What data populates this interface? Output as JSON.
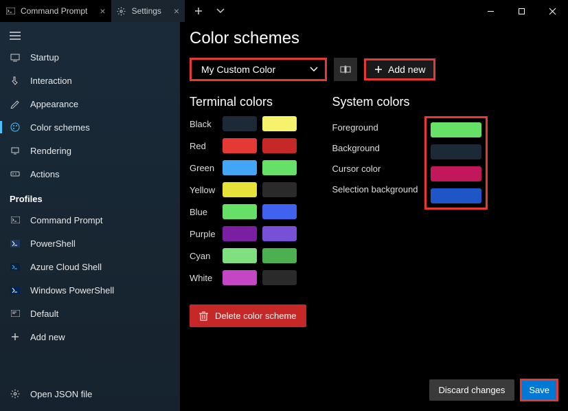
{
  "tabs": [
    {
      "label": "Command Prompt",
      "icon": "cmd"
    },
    {
      "label": "Settings",
      "icon": "gear"
    }
  ],
  "window_controls": {
    "new_tab": "+",
    "dropdown": "˅"
  },
  "sidebar": {
    "items": [
      {
        "label": "Startup",
        "icon": "startup"
      },
      {
        "label": "Interaction",
        "icon": "interaction"
      },
      {
        "label": "Appearance",
        "icon": "appearance"
      },
      {
        "label": "Color schemes",
        "icon": "palette",
        "selected": true
      },
      {
        "label": "Rendering",
        "icon": "rendering"
      },
      {
        "label": "Actions",
        "icon": "actions"
      }
    ],
    "profiles_header": "Profiles",
    "profiles": [
      {
        "label": "Command Prompt",
        "icon": "cmd"
      },
      {
        "label": "PowerShell",
        "icon": "ps"
      },
      {
        "label": "Azure Cloud Shell",
        "icon": "azure"
      },
      {
        "label": "Windows PowerShell",
        "icon": "ps"
      },
      {
        "label": "Default",
        "icon": "default"
      }
    ],
    "add_new": "Add new",
    "open_json": "Open JSON file"
  },
  "page": {
    "title": "Color schemes",
    "scheme_dropdown": "My Custom Color",
    "rename_hint": "Rename",
    "add_new_btn": "Add new",
    "terminal_title": "Terminal colors",
    "system_title": "System colors",
    "terminal_colors": [
      {
        "name": "Black",
        "a": "#1b2a36",
        "b": "#f7f26c"
      },
      {
        "name": "Red",
        "a": "#e53935",
        "b": "#c62828"
      },
      {
        "name": "Green",
        "a": "#42a5f5",
        "b": "#66e066"
      },
      {
        "name": "Yellow",
        "a": "#e6e23a",
        "b": "#2a2a2a"
      },
      {
        "name": "Blue",
        "a": "#66e066",
        "b": "#3f63f0"
      },
      {
        "name": "Purple",
        "a": "#7b1fa2",
        "b": "#7850d8"
      },
      {
        "name": "Cyan",
        "a": "#7fe07f",
        "b": "#4caf50"
      },
      {
        "name": "White",
        "a": "#c446c4",
        "b": "#2a2a2a"
      }
    ],
    "system_colors": [
      {
        "name": "Foreground",
        "color": "#66e066"
      },
      {
        "name": "Background",
        "color": "#1b2a36"
      },
      {
        "name": "Cursor color",
        "color": "#c2185b"
      },
      {
        "name": "Selection background",
        "color": "#1e56c8"
      }
    ],
    "delete_btn": "Delete color scheme",
    "discard_btn": "Discard changes",
    "save_btn": "Save"
  }
}
